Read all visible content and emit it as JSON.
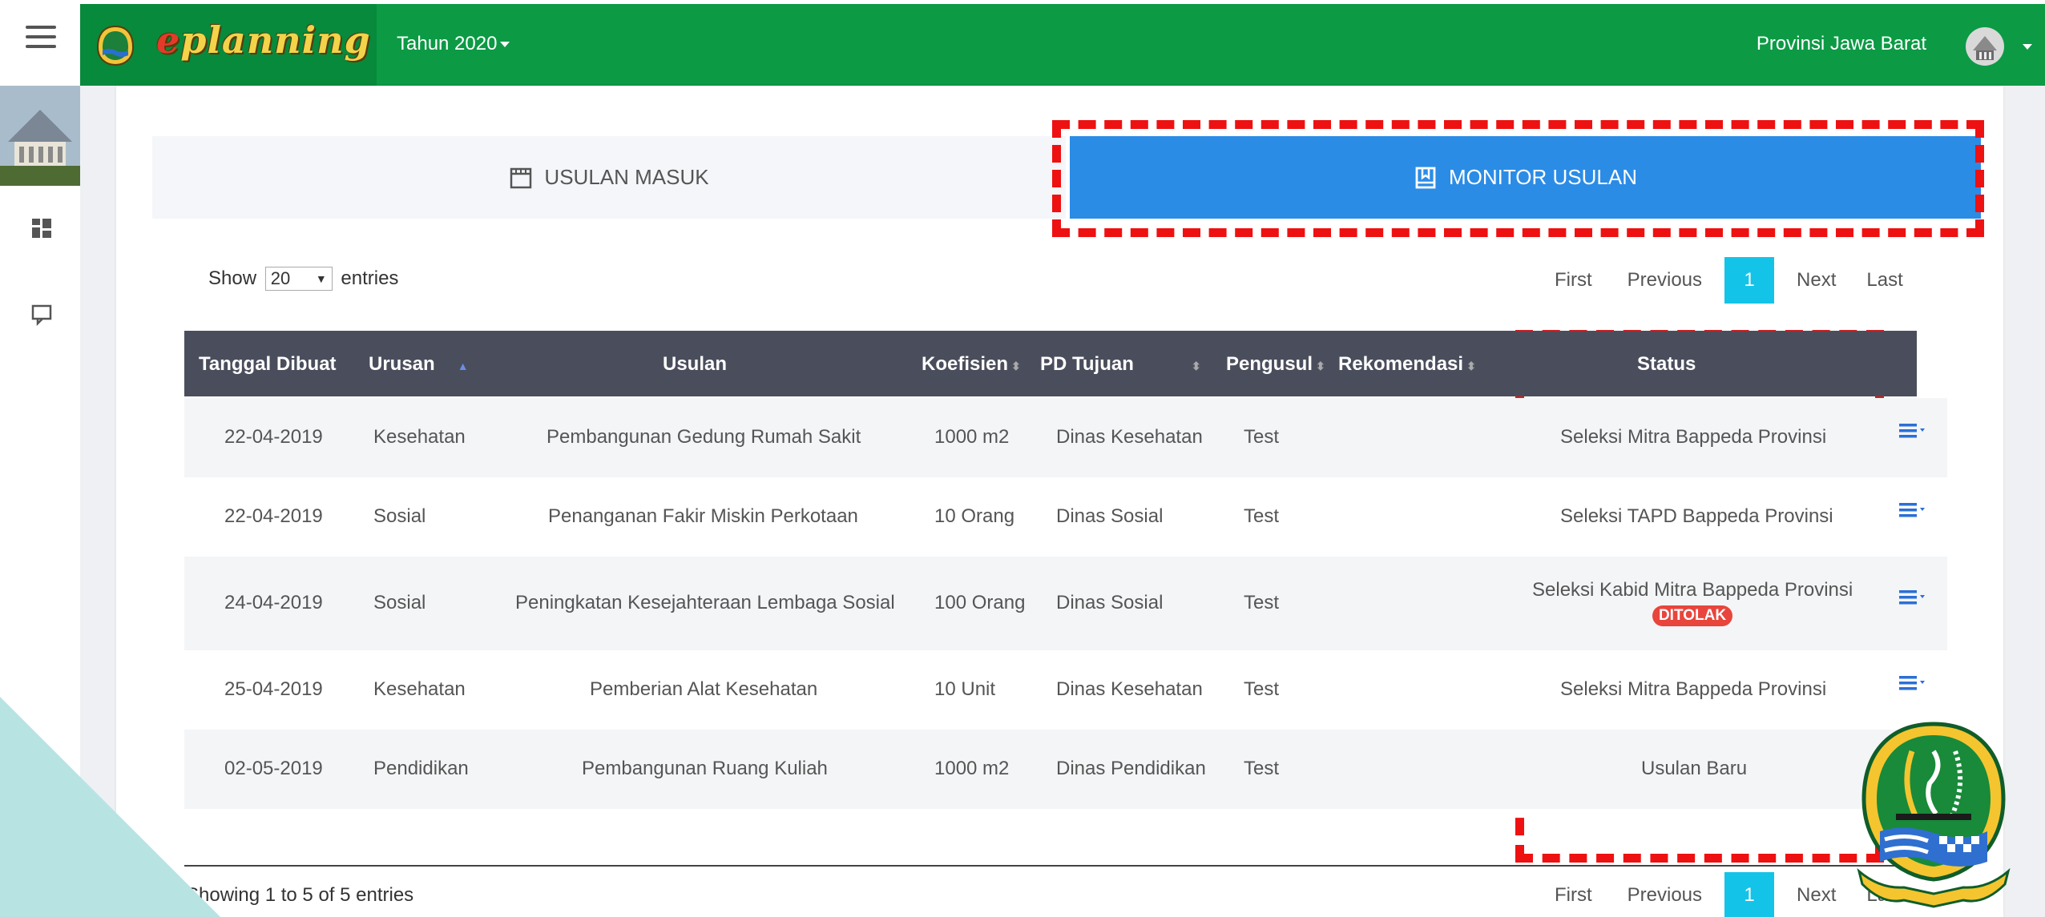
{
  "header": {
    "brand": "eplanning",
    "year_label": "Tahun 2020",
    "province": "Provinsi Jawa Barat"
  },
  "sidebar": {
    "items": [
      {
        "icon": "dashboard-icon"
      },
      {
        "icon": "chat-icon"
      }
    ]
  },
  "tabs": {
    "masuk": "USULAN MASUK",
    "monitor": "MONITOR USULAN"
  },
  "table_controls": {
    "show_label": "Show",
    "entries_value": "20",
    "entries_label": "entries",
    "info": "Showing 1 to 5 of 5 entries"
  },
  "pagination": {
    "first": "First",
    "previous": "Previous",
    "current": "1",
    "next": "Next",
    "last": "Last"
  },
  "table": {
    "columns": [
      "Tanggal Dibuat",
      "Urusan",
      "Usulan",
      "Koefisien",
      "PD Tujuan",
      "Pengusul",
      "Rekomendasi",
      "Status"
    ],
    "rows": [
      {
        "tanggal": "22-04-2019",
        "urusan": "Kesehatan",
        "usulan": "Pembangunan Gedung Rumah Sakit",
        "koefisien": "1000 m2",
        "pd": "Dinas Kesehatan",
        "pengusul": "Test",
        "rekomendasi": "",
        "status": "Seleksi Mitra Bappeda Provinsi",
        "badge": ""
      },
      {
        "tanggal": "22-04-2019",
        "urusan": "Sosial",
        "usulan": "Penanganan Fakir Miskin Perkotaan",
        "koefisien": "10 Orang",
        "pd": "Dinas Sosial",
        "pengusul": "Test",
        "rekomendasi": "",
        "status": "Seleksi TAPD Bappeda Provinsi",
        "badge": ""
      },
      {
        "tanggal": "24-04-2019",
        "urusan": "Sosial",
        "usulan": "Peningkatan Kesejahteraan Lembaga Sosial",
        "koefisien": "100 Orang",
        "pd": "Dinas Sosial",
        "pengusul": "Test",
        "rekomendasi": "",
        "status": "Seleksi Kabid Mitra Bappeda Provinsi",
        "badge": "DITOLAK"
      },
      {
        "tanggal": "25-04-2019",
        "urusan": "Kesehatan",
        "usulan": "Pemberian Alat Kesehatan",
        "koefisien": "10 Unit",
        "pd": "Dinas Kesehatan",
        "pengusul": "Test",
        "rekomendasi": "",
        "status": "Seleksi Mitra Bappeda Provinsi",
        "badge": ""
      },
      {
        "tanggal": "02-05-2019",
        "urusan": "Pendidikan",
        "usulan": "Pembangunan Ruang Kuliah",
        "koefisien": "1000 m2",
        "pd": "Dinas Pendidikan",
        "pengusul": "Test",
        "rekomendasi": "",
        "status": "Usulan Baru",
        "badge": ""
      }
    ]
  },
  "colors": {
    "topbar_green": "#0c9a45",
    "tab_active_blue": "#2b8ce6",
    "page_active_cyan": "#14c3e8",
    "highlight_red": "#ee1111",
    "badge_red": "#e8453c"
  }
}
